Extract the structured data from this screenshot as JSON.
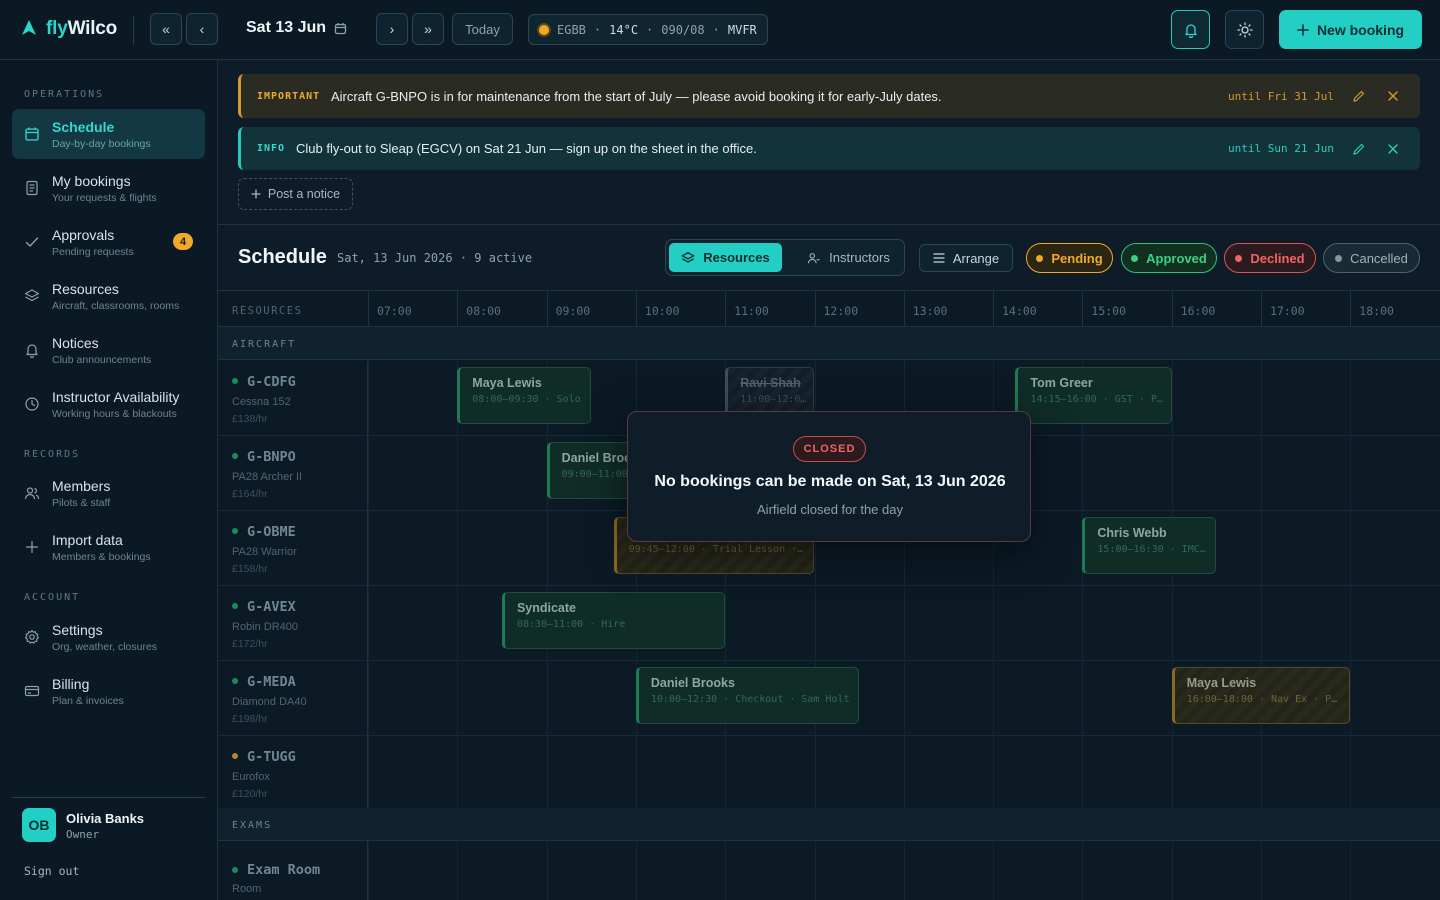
{
  "app": {
    "brand_prefix": "fly",
    "brand_suffix": "Wilco"
  },
  "topbar": {
    "date": "Sat 13 Jun",
    "today_label": "Today",
    "weather": {
      "station": "EGBB",
      "temp": "14°C",
      "wind": "090/08",
      "category": "MVFR"
    },
    "new_booking_label": "New booking",
    "nav_prev_week": "«",
    "nav_prev": "‹",
    "nav_next": "›",
    "nav_next_week": "»"
  },
  "sidebar": {
    "sections": {
      "operations": "OPERATIONS",
      "records": "RECORDS",
      "account": "ACCOUNT"
    },
    "items": [
      {
        "title": "Schedule",
        "subtitle": "Day-by-day bookings",
        "icon": "calendar-icon"
      },
      {
        "title": "My bookings",
        "subtitle": "Your requests & flights",
        "icon": "document-icon"
      },
      {
        "title": "Approvals",
        "subtitle": "Pending requests",
        "icon": "check-icon",
        "badge": "4"
      },
      {
        "title": "Resources",
        "subtitle": "Aircraft, classrooms, rooms",
        "icon": "layers-icon"
      },
      {
        "title": "Notices",
        "subtitle": "Club announcements",
        "icon": "bell-icon"
      },
      {
        "title": "Instructor Availability",
        "subtitle": "Working hours & blackouts",
        "icon": "clock-icon"
      },
      {
        "title": "Members",
        "subtitle": "Pilots & staff",
        "icon": "users-icon"
      },
      {
        "title": "Import data",
        "subtitle": "Members & bookings",
        "icon": "plus-icon"
      },
      {
        "title": "Settings",
        "subtitle": "Org, weather, closures",
        "icon": "gear-icon"
      },
      {
        "title": "Billing",
        "subtitle": "Plan & invoices",
        "icon": "card-icon"
      }
    ],
    "user": {
      "initials": "OB",
      "name": "Olivia Banks",
      "role": "Owner"
    },
    "sign_out": "Sign out"
  },
  "notices": [
    {
      "tag": "IMPORTANT",
      "text": "Aircraft G-BNPO is in for maintenance from the start of July — please avoid booking it for early-July dates.",
      "until": "until Fri 31 Jul"
    },
    {
      "tag": "INFO",
      "text": "Club fly-out to Sleap (EGCV) on Sat 21 Jun — sign up on the sheet in the office.",
      "until": "until Sun 21 Jun"
    }
  ],
  "post_notice_label": "Post a notice",
  "schedule": {
    "title": "Schedule",
    "subtitle": "Sat, 13 Jun 2026 · 9 active",
    "view_resources": "Resources",
    "view_instructors": "Instructors",
    "arrange_label": "Arrange",
    "filters": {
      "pending": "Pending",
      "approved": "Approved",
      "declined": "Declined",
      "cancelled": "Cancelled"
    },
    "resources_header": "RESOURCES",
    "hours": [
      "07:00",
      "08:00",
      "09:00",
      "10:00",
      "11:00",
      "12:00",
      "13:00",
      "14:00",
      "15:00",
      "16:00",
      "17:00",
      "18:00"
    ],
    "groups": {
      "aircraft": "AIRCRAFT",
      "exams": "EXAMS"
    },
    "aircraft": [
      {
        "reg": "G-CDFG",
        "model": "Cessna 152",
        "rate": "£138/hr",
        "status": "green"
      },
      {
        "reg": "G-BNPO",
        "model": "PA28 Archer II",
        "rate": "£164/hr",
        "status": "green"
      },
      {
        "reg": "G-OBME",
        "model": "PA28 Warrior",
        "rate": "£158/hr",
        "status": "green"
      },
      {
        "reg": "G-AVEX",
        "model": "Robin DR400",
        "rate": "£172/hr",
        "status": "green"
      },
      {
        "reg": "G-MEDA",
        "model": "Diamond DA40",
        "rate": "£198/hr",
        "status": "green"
      },
      {
        "reg": "G-TUGG",
        "model": "Eurofox",
        "rate": "£120/hr",
        "status": "amber"
      }
    ],
    "exam_rooms": [
      {
        "reg": "Exam Room",
        "model": "Room"
      }
    ],
    "bookings": [
      {
        "name": "Maya Lewis",
        "detail": "08:00–09:30 · Solo",
        "row": 0,
        "start": 8.0,
        "end": 9.5,
        "status": "approved"
      },
      {
        "name": "Ravi Shah",
        "detail": "11:00–12:0…",
        "row": 0,
        "start": 11.0,
        "end": 12.0,
        "status": "cancelled"
      },
      {
        "name": "Tom Greer",
        "detail": "14:15–16:00 · GST · P…",
        "row": 0,
        "start": 14.25,
        "end": 16.0,
        "status": "approved"
      },
      {
        "name": "Daniel Broo",
        "detail": "09:00–11:00",
        "row": 1,
        "start": 9.0,
        "end": 11.0,
        "status": "approved"
      },
      {
        "name": "",
        "detail": "09:45–12:00 · Trial Lesson ·…",
        "row": 2,
        "start": 9.75,
        "end": 12.0,
        "status": "pending"
      },
      {
        "name": "Chris Webb",
        "detail": "15:00–16:30 · IMC…",
        "row": 2,
        "start": 15.0,
        "end": 16.5,
        "status": "approved"
      },
      {
        "name": "Syndicate",
        "detail": "08:30–11:00 · Hire",
        "row": 3,
        "start": 8.5,
        "end": 11.0,
        "status": "approved"
      },
      {
        "name": "Daniel Brooks",
        "detail": "10:00–12:30 · Checkout · Sam Holt",
        "row": 4,
        "start": 10.0,
        "end": 12.5,
        "status": "approved"
      },
      {
        "name": "Maya Lewis",
        "detail": "16:00–18:00 · Nav Ex · P…",
        "row": 4,
        "start": 16.0,
        "end": 18.0,
        "status": "pending"
      }
    ]
  },
  "closure_modal": {
    "tag": "CLOSED",
    "title": "No bookings can be made on Sat, 13 Jun 2026",
    "subtitle": "Airfield closed for the day"
  }
}
